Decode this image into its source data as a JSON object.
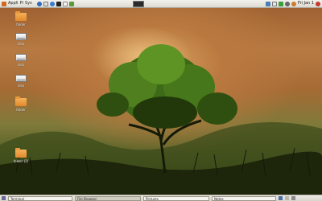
{
  "top_panel": {
    "menus": [
      {
        "label": "Applications",
        "short": "Appli"
      },
      {
        "label": "Places",
        "short": "Pl"
      },
      {
        "label": "System",
        "short": "Sys"
      }
    ],
    "clock": "Fri Jan 1"
  },
  "desktop_icons": [
    {
      "label": "folder",
      "kind": "folder"
    },
    {
      "label": "disk",
      "kind": "drive"
    },
    {
      "label": "disk",
      "kind": "drive"
    },
    {
      "label": "disk",
      "kind": "drive"
    },
    {
      "label": "folder",
      "kind": "folder"
    },
    {
      "label": "folder (2)",
      "kind": "folder"
    }
  ],
  "bottom_panel": {
    "tasks": [
      {
        "label": "Terminal",
        "active": false
      },
      {
        "label": "File Browser",
        "active": true
      },
      {
        "label": "Pictures",
        "active": false
      },
      {
        "label": "Notes",
        "active": false
      }
    ]
  },
  "colors": {
    "folder": "#f0a04a",
    "panel": "#e6e4dd",
    "sky_glow": "#d8a05e",
    "foliage": "#4f7f1e"
  }
}
